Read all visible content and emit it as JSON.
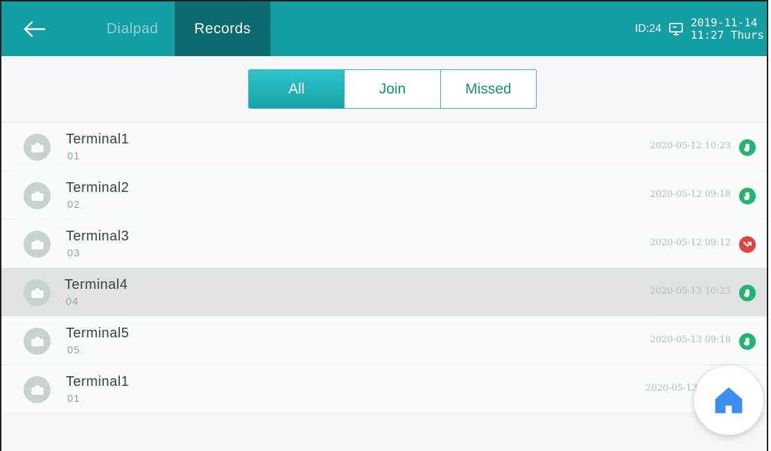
{
  "topbar": {
    "tabs": [
      {
        "label": "Dialpad",
        "active": false
      },
      {
        "label": "Records",
        "active": true
      }
    ],
    "device_id": "ID:24",
    "date": "2019-11-14",
    "time": "11:27 Thurs",
    "accent_color": "#139ea3"
  },
  "filter": {
    "options": [
      {
        "label": "All",
        "active": true
      },
      {
        "label": "Join",
        "active": false
      },
      {
        "label": "Missed",
        "active": false
      }
    ]
  },
  "records": [
    {
      "name": "Terminal1",
      "number": "01",
      "datetime": "2020-05-12 10:23",
      "status": "connected",
      "selected": false
    },
    {
      "name": "Terminal2",
      "number": "02",
      "datetime": "2020-05-12 09:18",
      "status": "connected",
      "selected": false
    },
    {
      "name": "Terminal3",
      "number": "03",
      "datetime": "2020-05-12 09:12",
      "status": "missed",
      "selected": false
    },
    {
      "name": "Terminal4",
      "number": "04",
      "datetime": "2020-05-13 10:23",
      "status": "connected",
      "selected": true
    },
    {
      "name": "Terminal5",
      "number": "05",
      "datetime": "2020-05-13 09:18",
      "status": "connected",
      "selected": false
    },
    {
      "name": "Terminal1",
      "number": "01",
      "datetime": "2020-05-13",
      "status": "missed",
      "selected": false
    }
  ],
  "icons": {
    "back": "arrow-left-icon",
    "screen": "monitor-icon",
    "avatar": "user-group-icon",
    "connected": "hand-icon",
    "missed": "missed-call-icon",
    "home": "home-icon"
  },
  "colors": {
    "connected": "#21b56e",
    "missed": "#e04343",
    "home": "#3d8ef0"
  }
}
